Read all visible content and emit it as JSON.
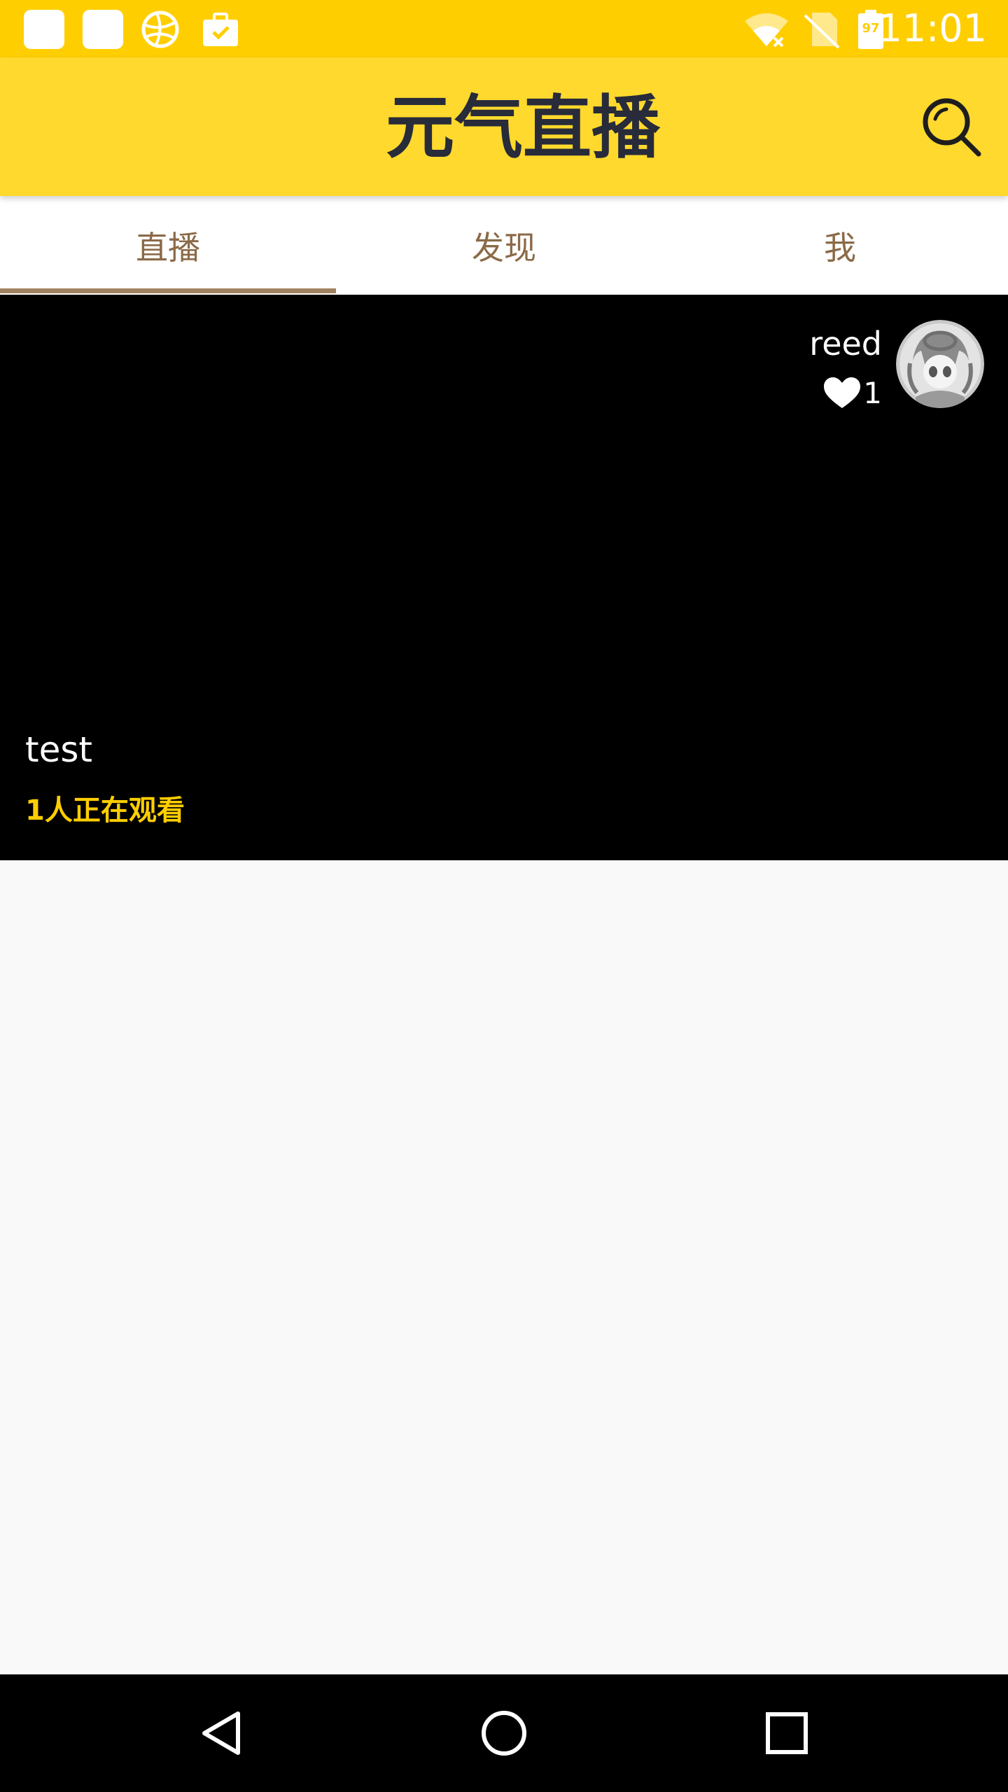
{
  "status_bar": {
    "time": "11:01",
    "battery_level": "97",
    "icons": [
      "notification-square-icon",
      "notification-square-icon",
      "globe-icon",
      "briefcase-check-icon",
      "wifi-icon",
      "no-sim-icon",
      "battery-icon"
    ]
  },
  "app_bar": {
    "logo_text": "元气直播",
    "search_icon": "search-icon",
    "accent_color": "#ffd92d"
  },
  "tabs": [
    {
      "label": "直播",
      "selected": true
    },
    {
      "label": "发现",
      "selected": false
    },
    {
      "label": "我",
      "selected": false
    }
  ],
  "live_card": {
    "host_name": "reed",
    "like_count": "1",
    "title": "test",
    "viewers": "1人正在观看"
  },
  "nav_bar": {
    "icons": [
      "back-icon",
      "home-icon",
      "recents-icon"
    ]
  }
}
